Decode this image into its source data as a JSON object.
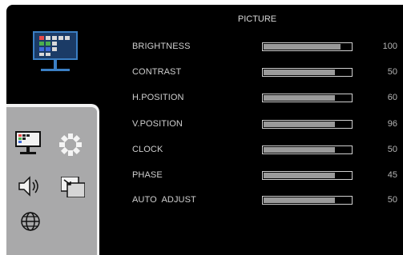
{
  "menu": {
    "title": "PICTURE",
    "items": [
      {
        "label": "BRIGHTNESS",
        "value": "100",
        "level": 0.88
      },
      {
        "label": "CONTRAST",
        "value": "50",
        "level": 0.82
      },
      {
        "label": "H.POSITION",
        "value": "60",
        "level": 0.82
      },
      {
        "label": "V.POSITION",
        "value": "96",
        "level": 0.82
      },
      {
        "label": "CLOCK",
        "value": "50",
        "level": 0.82
      },
      {
        "label": "PHASE",
        "value": "45",
        "level": 0.82
      },
      {
        "label": "AUTO  ADJUST",
        "value": "50",
        "level": 0.82
      }
    ]
  },
  "sidebar": {
    "icons": [
      "picture-icon",
      "settings-gear-icon",
      "audio-speaker-icon",
      "input-source-icon",
      "language-globe-icon"
    ]
  },
  "colors": {
    "panel_bg": "#000000",
    "sidebar_bg": "#a9a9aa",
    "bar_fill": "#9a9a9a",
    "text": "#cfcfcf"
  }
}
